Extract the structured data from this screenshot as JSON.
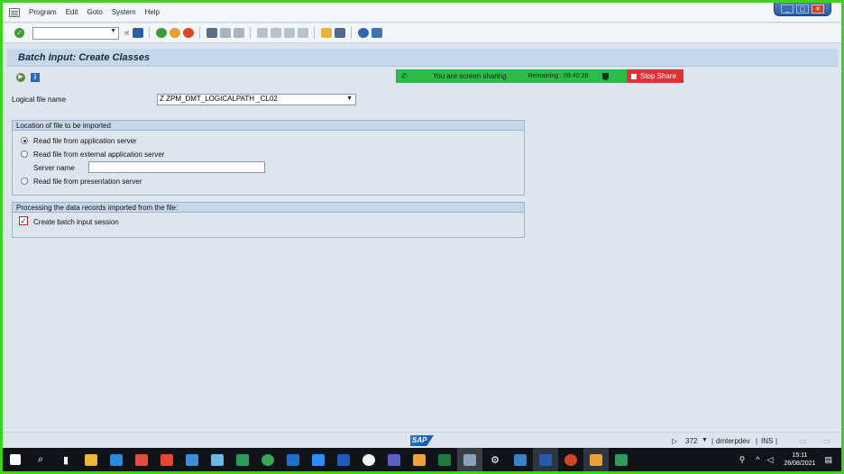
{
  "menu": {
    "items": [
      "Program",
      "Edit",
      "Goto",
      "System",
      "Help"
    ]
  },
  "window_controls": {
    "minimize": "_",
    "restore": "▢",
    "close": "✕"
  },
  "toolbar": {
    "command_field_value": "",
    "icons": [
      "enter-icon",
      "back-icon",
      "save-icon",
      "back-green-icon",
      "exit-icon",
      "cancel-icon",
      "print-icon",
      "find-icon",
      "find-next-icon",
      "first-page-icon",
      "prev-page-icon",
      "next-page-icon",
      "last-page-icon",
      "create-session-icon",
      "shortcut-icon",
      "help-icon",
      "layout-icon"
    ]
  },
  "title": "Batch Input: Create Classes",
  "screen_share": {
    "message": "You are screen sharing",
    "remaining": "Remaining : 09:40:28",
    "stop_label": "Stop Share",
    "color": "#2eba48",
    "stop_color": "#e03236"
  },
  "form": {
    "logical_file_label": "Logical file name",
    "logical_file_value": "Z ZPM_DMT_LOGICALPATH _CL02",
    "location_group": {
      "title": "Location of file to be imported",
      "options": [
        {
          "label": "Read file from application server",
          "selected": true
        },
        {
          "label": "Read file from external application server",
          "selected": false
        },
        {
          "label": "Read file from presentation server",
          "selected": false
        }
      ],
      "server_name_label": "Server name",
      "server_name_value": ""
    },
    "processing_group": {
      "title": "Processing the data records imported from the file:",
      "checkbox_label": "Create batch input session",
      "checked": true
    }
  },
  "statusbar": {
    "logo": "SAP",
    "session": "372",
    "server": "dmterpdev",
    "mode": "INS"
  },
  "taskbar": {
    "time": "15:11",
    "date": "26/08/2021",
    "apps": [
      "windows-start-icon",
      "search-icon",
      "task-view-icon",
      "file-explorer-icon",
      "mail-icon",
      "popcorn-icon",
      "s-app-icon",
      "store-icon",
      "notepad-icon",
      "app-icon",
      "chrome-icon",
      "outlook-icon",
      "zoom-icon",
      "vs-code-icon",
      "itunes-icon",
      "teams-icon",
      "tasks-icon",
      "excel-icon",
      "taskbar-app-icon",
      "settings-icon",
      "app2-icon",
      "word-icon",
      "powerpoint-icon",
      "sap-logon-icon",
      "tray-icon"
    ]
  }
}
